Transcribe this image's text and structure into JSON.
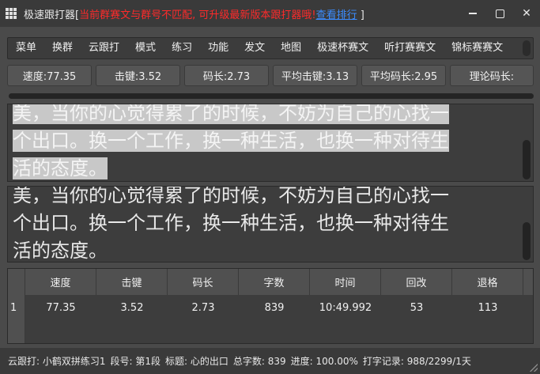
{
  "titlebar": {
    "app_name": "极速跟打器",
    "bracket_open": "[",
    "warning": "当前群赛文与群号不匹配, 可升级最新版本跟打器哦!",
    "link": "查看排行",
    "bracket_close": " ]"
  },
  "menu": {
    "items": [
      "菜单",
      "换群",
      "云跟打",
      "模式",
      "练习",
      "功能",
      "发文",
      "地图",
      "极速杯赛文",
      "听打赛赛文",
      "锦标赛赛文"
    ]
  },
  "stats": [
    {
      "label": "速度:77.35"
    },
    {
      "label": "击键:3.52"
    },
    {
      "label": "码长:2.73"
    },
    {
      "label": "平均击键:3.13"
    },
    {
      "label": "平均码长:2.95"
    },
    {
      "label": "理论码长:"
    }
  ],
  "reference_text": {
    "line1": "美，当你的心觉得累了的时候，不妨为自己的心找一",
    "line2": "个出口。换一个工作，换一种生活，也换一种对待生",
    "line3": "活的态度。"
  },
  "typed_text": {
    "line1": "美，当你的心觉得累了的时候，不妨为自己的心找一",
    "line2": "个出口。换一个工作，换一种生活，也换一种对待生",
    "line3": "活的态度。"
  },
  "table": {
    "headers": [
      "速度",
      "击键",
      "码长",
      "字数",
      "时间",
      "回改",
      "退格"
    ],
    "rows": [
      {
        "num": "1",
        "cells": [
          "77.35",
          "3.52",
          "2.73",
          "839",
          "10:49.992",
          "53",
          "113"
        ]
      }
    ]
  },
  "status": {
    "cloud": "云跟打: 小鹤双拼练习1",
    "segment": "段号: 第1段",
    "title": "标题: 心的出口",
    "total": "总字数: 839",
    "progress": "进度: 100.00%",
    "record": "打字记录: 988/2299/1天"
  },
  "colors": {
    "warning": "#ff2a2a",
    "link": "#3b8cff",
    "highlight": "#c8c8c8"
  }
}
